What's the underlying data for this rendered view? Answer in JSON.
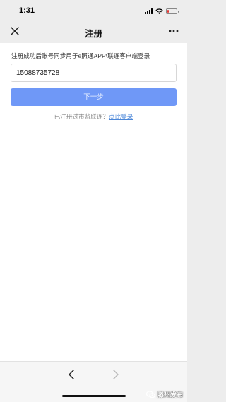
{
  "status_bar": {
    "time": "1:31",
    "battery_level": 0.2,
    "battery_color": "#e53935"
  },
  "nav": {
    "title": "注册",
    "close_icon": "close-icon",
    "more_icon": "more-icon"
  },
  "form": {
    "description": "注册成功后账号同步用于e照通APP\\联连客户端登录",
    "phone_value": "15088735728",
    "next_label": "下一步",
    "login_hint": "已注册过市监联连？",
    "login_link": "点此登录"
  },
  "bottom_bar": {
    "back_icon": "chevron-left-icon",
    "forward_icon": "chevron-right-icon"
  },
  "watermark": {
    "text": "滕州发布"
  },
  "colors": {
    "accent": "#6f98f7",
    "link": "#4a86d8",
    "background": "#ededed"
  }
}
